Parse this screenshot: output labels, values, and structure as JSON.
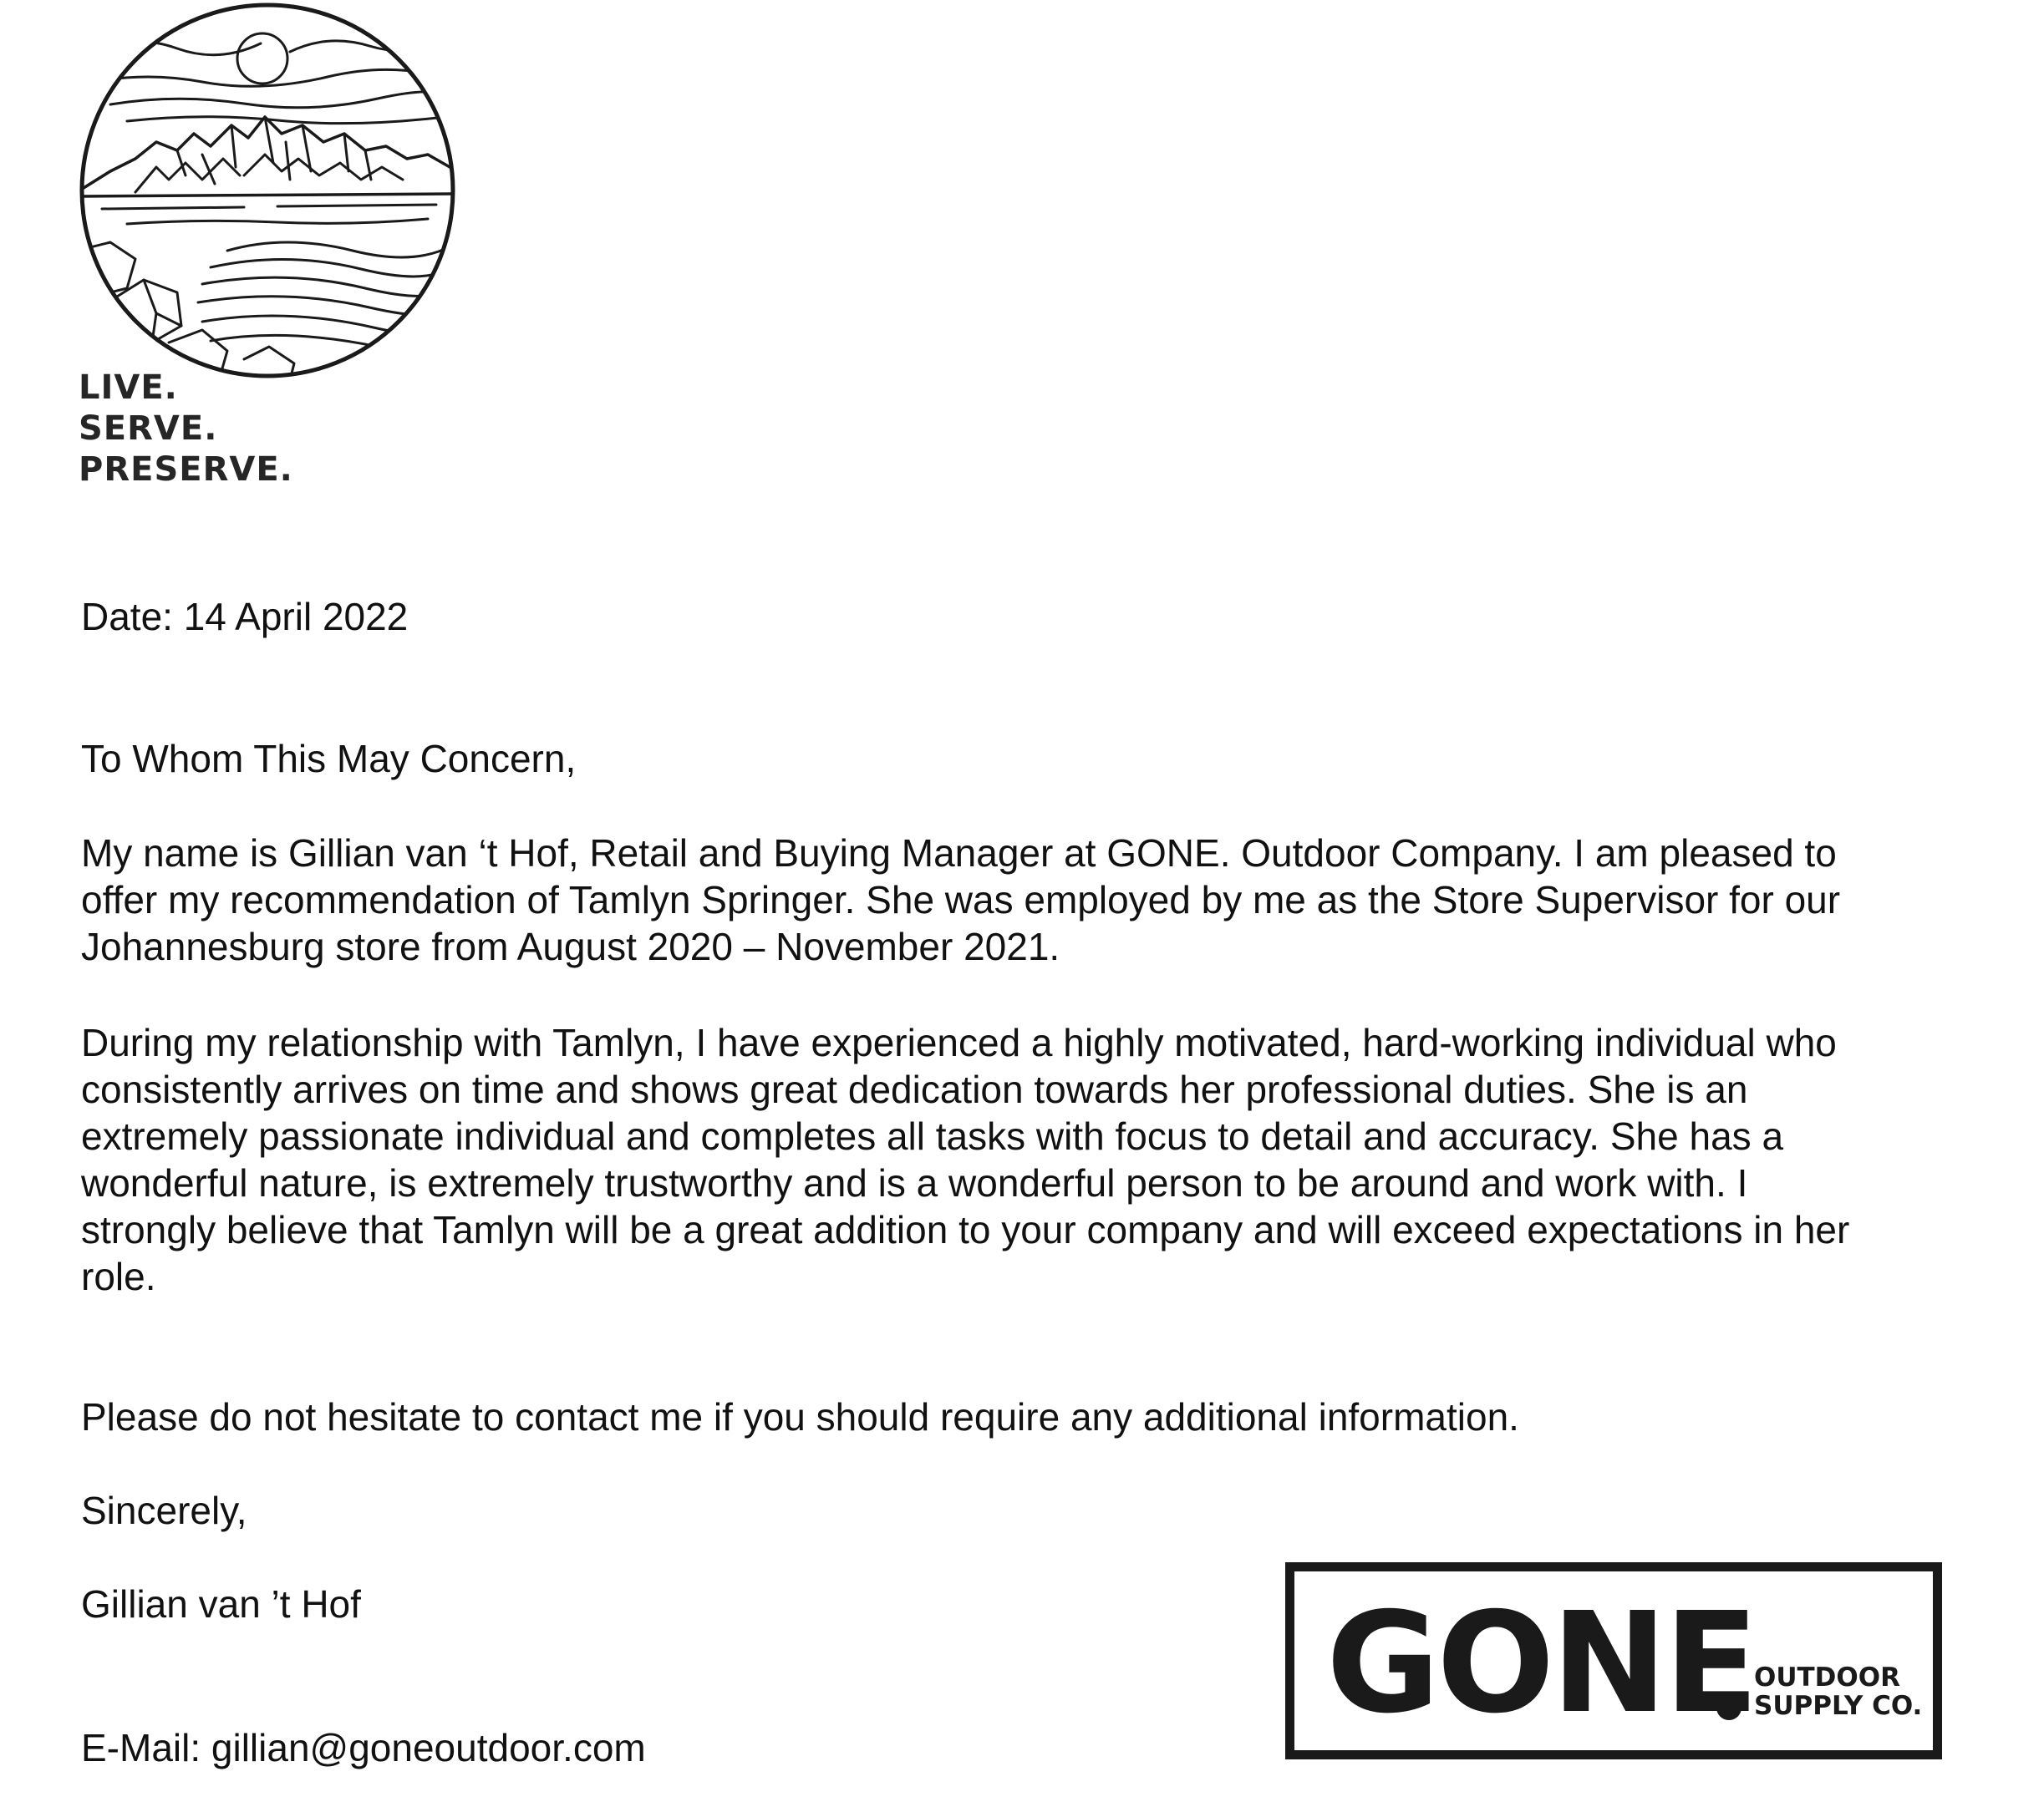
{
  "header": {
    "tagline": [
      "LIVE.",
      "SERVE.",
      "PRESERVE."
    ]
  },
  "letter": {
    "date": "Date: 14 April 2022",
    "salutation": "To Whom This May Concern,",
    "paragraph1": [
      "My name is Gillian van ‘t Hof, Retail and Buying Manager at GONE. Outdoor Company. I am pleased to",
      "offer my recommendation of Tamlyn Springer. She was employed by me as the Store Supervisor for our",
      "Johannesburg store from August 2020 – November 2021."
    ],
    "paragraph2": [
      "During my relationship with Tamlyn, I have experienced a highly motivated, hard-working individual who",
      "consistently arrives on time and shows great dedication towards her professional duties. She is an",
      "extremely passionate individual and completes all tasks with focus to detail and accuracy. She has a",
      "wonderful nature, is extremely trustworthy and is a wonderful person to be around and work with. I",
      "strongly believe that Tamlyn will be a great addition to your company and will exceed expectations in her",
      "role."
    ],
    "paragraph3": "Please do not hesitate to contact me if you should require any additional information.",
    "closing": "Sincerely,",
    "signatory": "Gillian van ’t Hof",
    "email": "E-Mail: gillian@goneoutdoor.com"
  },
  "logo": {
    "wordmark": "GONE",
    "subline": [
      "OUTDOOR",
      "SUPPLY CO."
    ]
  }
}
